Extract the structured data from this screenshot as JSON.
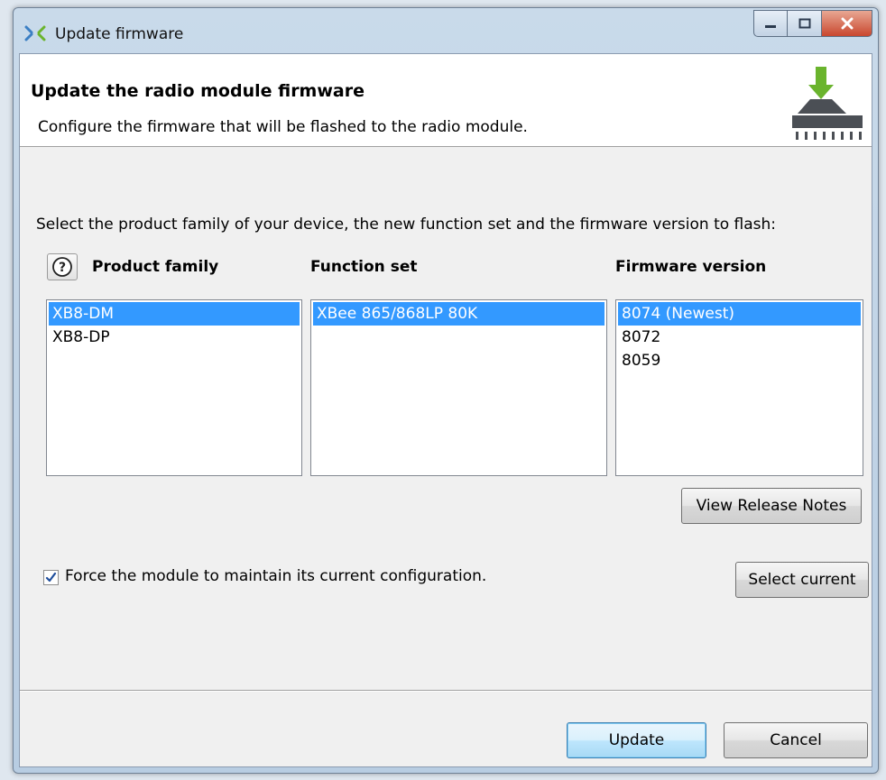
{
  "window": {
    "title": "Update firmware"
  },
  "header": {
    "title": "Update the radio module firmware",
    "subtitle": "Configure the firmware that will be flashed to the radio module."
  },
  "instructions": "Select the product family of your device, the new function set and the firmware version to flash:",
  "columns": {
    "product_family": {
      "label": "Product family",
      "items": [
        "XB8-DM",
        "XB8-DP"
      ],
      "selected": "XB8-DM"
    },
    "function_set": {
      "label": "Function set",
      "items": [
        "XBee 865/868LP 80K"
      ],
      "selected": "XBee 865/868LP 80K"
    },
    "firmware_version": {
      "label": "Firmware version",
      "items": [
        "8074 (Newest)",
        "8072",
        "8059"
      ],
      "selected": "8074 (Newest)"
    }
  },
  "buttons": {
    "view_release_notes": "View Release Notes",
    "select_current": "Select current",
    "update": "Update",
    "cancel": "Cancel"
  },
  "force_config": {
    "label": "Force the module to maintain its current configuration.",
    "checked": true
  },
  "icons": {
    "app": "xbee-app-icon",
    "help": "help-icon",
    "header": "firmware-download-chip-icon"
  },
  "colors": {
    "selection": "#3399ff",
    "download_arrow": "#6ab42d",
    "close_button": "#c9472e"
  }
}
